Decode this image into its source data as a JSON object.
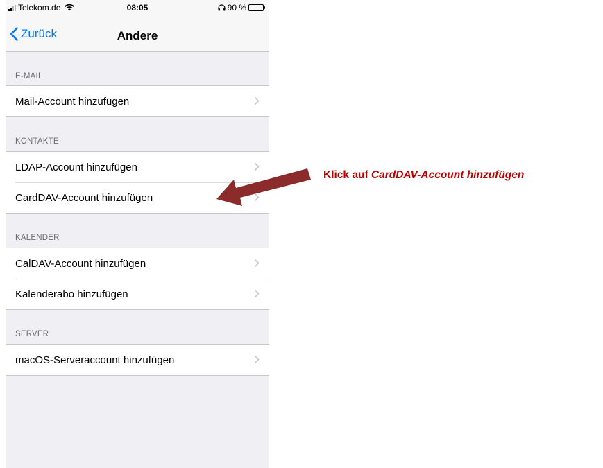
{
  "status_bar": {
    "carrier": "Telekom.de",
    "time": "08:05",
    "battery_label": "90 %",
    "battery_level": 0.9
  },
  "nav": {
    "back_label": "Zurück",
    "title": "Andere"
  },
  "sections": [
    {
      "header": "E-MAIL",
      "items": [
        "Mail-Account hinzufügen"
      ]
    },
    {
      "header": "KONTAKTE",
      "items": [
        "LDAP-Account hinzufügen",
        "CardDAV-Account hinzufügen"
      ]
    },
    {
      "header": "KALENDER",
      "items": [
        "CalDAV-Account hinzufügen",
        "Kalenderabo hinzufügen"
      ]
    },
    {
      "header": "SERVER",
      "items": [
        "macOS-Serveraccount hinzufügen"
      ]
    }
  ],
  "annotation": {
    "prefix": "Klick auf ",
    "target": "CardDAV-Account hinzufügen",
    "color": "#c00000",
    "arrow_color": "#8b2b2b"
  },
  "colors": {
    "accent": "#007aff",
    "background": "#efeff4",
    "separator": "#c8c7cc",
    "section_text": "#6d6d72"
  },
  "icons": [
    "signal-icon",
    "wifi-icon",
    "headphones-icon",
    "battery-icon",
    "chevron-left-icon",
    "chevron-right-icon"
  ]
}
